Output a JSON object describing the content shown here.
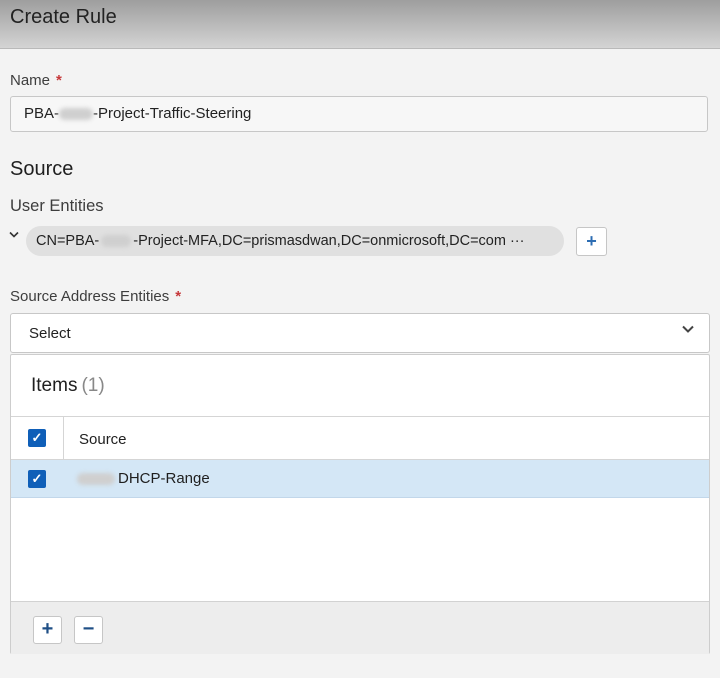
{
  "dialog": {
    "title": "Create Rule"
  },
  "name_field": {
    "label": "Name",
    "required_mark": "*",
    "value_prefix": "PBA-",
    "value_suffix": "-Project-Traffic-Steering"
  },
  "source": {
    "heading": "Source",
    "user_entities": {
      "label": "User Entities",
      "entity_prefix": "CN=PBA-",
      "entity_suffix": "-Project-MFA,DC=prismasdwan,DC=onmicrosoft,DC=com",
      "overflow": "···",
      "add_label": "+"
    },
    "address_entities": {
      "label": "Source Address Entities",
      "required_mark": "*",
      "select_value": "Select",
      "items_label": "Items",
      "items_count": "(1)",
      "column_header": "Source",
      "rows": [
        {
          "value": "DHCP-Range",
          "checked": true
        }
      ],
      "add_label": "+",
      "remove_label": "−"
    }
  },
  "icons": {
    "expand": "chevron-down-icon",
    "select_dropdown": "chevron-down-icon",
    "checkbox": "checkmark-icon"
  }
}
